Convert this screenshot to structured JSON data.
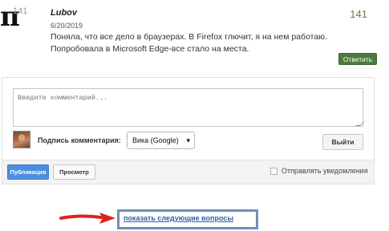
{
  "comment": {
    "avatar_glyph": "π",
    "avatar_number": "141",
    "author": "Lubov",
    "date": "6/20/2019",
    "count": "141",
    "text": "Поняла, что все дело в браузерах. В Firefox глючит, я на нем работаю. Попробовала в Microsoft Edge-все стало на места.",
    "reply_label": "Ответить",
    "accent_color": "#4f7a3f"
  },
  "form": {
    "textarea_placeholder": "Введите комментарий...",
    "sign_label": "Подпись комментария:",
    "select_value": "Вика (Google)",
    "select_caret": "▾",
    "logout_label": "Выйти",
    "publish_label": "Публикация",
    "preview_label": "Просмотр",
    "notify_label": "Отправлять уведомления",
    "notify_checked": false
  },
  "footer": {
    "show_more_label": "показать следующие вопросы",
    "arrow_color": "#e02020"
  },
  "icons": {
    "avatar": "pi-avatar-icon",
    "user": "user-avatar-icon",
    "caret": "chevron-down-icon",
    "arrow": "red-arrow-icon",
    "resize": "resize-handle-icon"
  }
}
